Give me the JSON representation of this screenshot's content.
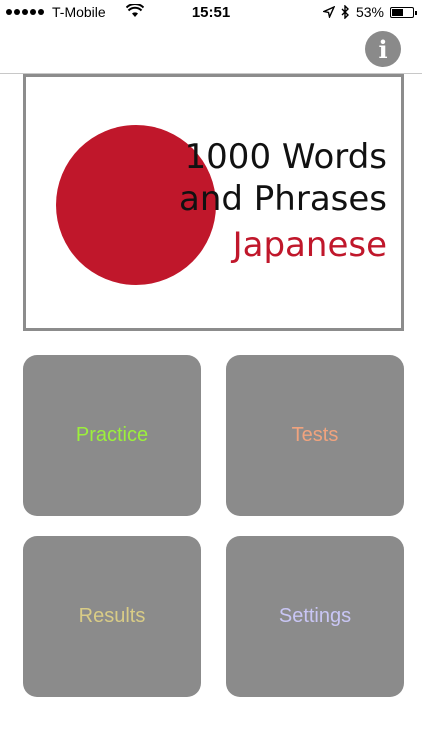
{
  "status_bar": {
    "carrier": "T-Mobile",
    "time": "15:51",
    "battery": "53%",
    "battery_level": 0.53
  },
  "header": {
    "info_icon": "info-icon",
    "info_glyph": "i"
  },
  "banner": {
    "title_line1": "1000 Words",
    "title_line2": "and Phrases",
    "language": "Japanese",
    "accent_color": "#c0172b"
  },
  "menu": {
    "practice": {
      "label": "Practice",
      "color": "#9cef3c"
    },
    "tests": {
      "label": "Tests",
      "color": "#f0a37e"
    },
    "results": {
      "label": "Results",
      "color": "#d9cc86"
    },
    "settings": {
      "label": "Settings",
      "color": "#c9c6f5"
    }
  },
  "colors": {
    "tile_background": "#8b8b8b",
    "banner_border": "#8c8c8c"
  }
}
